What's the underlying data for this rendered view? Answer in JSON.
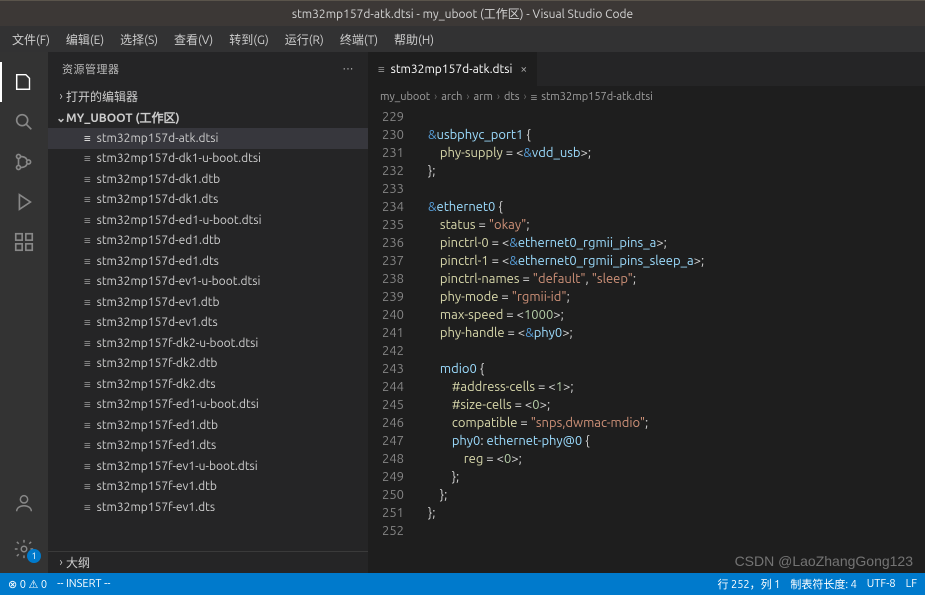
{
  "title": "stm32mp157d-atk.dtsi - my_uboot (工作区) - Visual Studio Code",
  "menu": [
    "文件(F)",
    "编辑(E)",
    "选择(S)",
    "查看(V)",
    "转到(G)",
    "运行(R)",
    "终端(T)",
    "帮助(H)"
  ],
  "activity_icons": [
    "files",
    "search",
    "scm",
    "debug",
    "extensions"
  ],
  "activity_bottom": [
    "account",
    "settings"
  ],
  "settings_badge": "1",
  "sidebar": {
    "title": "资源管理器",
    "ellipsis": "···",
    "open_editors": "打开的编辑器",
    "workspace": "MY_UBOOT (工作区)",
    "outline": "大纲",
    "files": [
      "stm32mp157d-atk.dtsi",
      "stm32mp157d-dk1-u-boot.dtsi",
      "stm32mp157d-dk1.dtb",
      "stm32mp157d-dk1.dts",
      "stm32mp157d-ed1-u-boot.dtsi",
      "stm32mp157d-ed1.dtb",
      "stm32mp157d-ed1.dts",
      "stm32mp157d-ev1-u-boot.dtsi",
      "stm32mp157d-ev1.dtb",
      "stm32mp157d-ev1.dts",
      "stm32mp157f-dk2-u-boot.dtsi",
      "stm32mp157f-dk2.dtb",
      "stm32mp157f-dk2.dts",
      "stm32mp157f-ed1-u-boot.dtsi",
      "stm32mp157f-ed1.dtb",
      "stm32mp157f-ed1.dts",
      "stm32mp157f-ev1-u-boot.dtsi",
      "stm32mp157f-ev1.dtb",
      "stm32mp157f-ev1.dts"
    ]
  },
  "tab": {
    "label": "stm32mp157d-atk.dtsi"
  },
  "breadcrumbs": [
    "my_uboot",
    "arch",
    "arm",
    "dts",
    "stm32mp157d-atk.dtsi"
  ],
  "code_start": 229,
  "code_tokens": [
    [],
    [
      [
        "amp",
        "&"
      ],
      [
        "var",
        "usbphyc_port1"
      ],
      [
        "punc",
        " {"
      ]
    ],
    [
      [
        "punc",
        "    "
      ],
      [
        "id",
        "phy-supply"
      ],
      [
        "punc",
        " = <"
      ],
      [
        "amp",
        "&"
      ],
      [
        "var",
        "vdd_usb"
      ],
      [
        "punc",
        ">;"
      ]
    ],
    [
      [
        "punc",
        "};"
      ]
    ],
    [],
    [
      [
        "amp",
        "&"
      ],
      [
        "var",
        "ethernet0"
      ],
      [
        "punc",
        " {"
      ]
    ],
    [
      [
        "punc",
        "    "
      ],
      [
        "id",
        "status"
      ],
      [
        "punc",
        " = "
      ],
      [
        "str",
        "\"okay\""
      ],
      [
        "punc",
        ";"
      ]
    ],
    [
      [
        "punc",
        "    "
      ],
      [
        "id",
        "pinctrl-0"
      ],
      [
        "punc",
        " = <"
      ],
      [
        "amp",
        "&"
      ],
      [
        "var",
        "ethernet0_rgmii_pins_a"
      ],
      [
        "punc",
        ">;"
      ]
    ],
    [
      [
        "punc",
        "    "
      ],
      [
        "id",
        "pinctrl-1"
      ],
      [
        "punc",
        " = <"
      ],
      [
        "amp",
        "&"
      ],
      [
        "var",
        "ethernet0_rgmii_pins_sleep_a"
      ],
      [
        "punc",
        ">;"
      ]
    ],
    [
      [
        "punc",
        "    "
      ],
      [
        "id",
        "pinctrl-names"
      ],
      [
        "punc",
        " = "
      ],
      [
        "str",
        "\"default\""
      ],
      [
        "punc",
        ", "
      ],
      [
        "str",
        "\"sleep\""
      ],
      [
        "punc",
        ";"
      ]
    ],
    [
      [
        "punc",
        "    "
      ],
      [
        "id",
        "phy-mode"
      ],
      [
        "punc",
        " = "
      ],
      [
        "str",
        "\"rgmii-id\""
      ],
      [
        "punc",
        ";"
      ]
    ],
    [
      [
        "punc",
        "    "
      ],
      [
        "id",
        "max-speed"
      ],
      [
        "punc",
        " = <"
      ],
      [
        "num",
        "1000"
      ],
      [
        "punc",
        ">;"
      ]
    ],
    [
      [
        "punc",
        "    "
      ],
      [
        "id",
        "phy-handle"
      ],
      [
        "punc",
        " = <"
      ],
      [
        "amp",
        "&"
      ],
      [
        "var",
        "phy0"
      ],
      [
        "punc",
        ">;"
      ]
    ],
    [],
    [
      [
        "punc",
        "    "
      ],
      [
        "var",
        "mdio0"
      ],
      [
        "punc",
        " {"
      ]
    ],
    [
      [
        "punc",
        "        "
      ],
      [
        "id",
        "#address-cells"
      ],
      [
        "punc",
        " = <"
      ],
      [
        "num",
        "1"
      ],
      [
        "punc",
        ">;"
      ]
    ],
    [
      [
        "punc",
        "        "
      ],
      [
        "id",
        "#size-cells"
      ],
      [
        "punc",
        " = <"
      ],
      [
        "num",
        "0"
      ],
      [
        "punc",
        ">;"
      ]
    ],
    [
      [
        "punc",
        "        "
      ],
      [
        "id",
        "compatible"
      ],
      [
        "punc",
        " = "
      ],
      [
        "str",
        "\"snps,dwmac-mdio\""
      ],
      [
        "punc",
        ";"
      ]
    ],
    [
      [
        "punc",
        "        "
      ],
      [
        "var",
        "phy0"
      ],
      [
        "punc",
        ": "
      ],
      [
        "var",
        "ethernet-phy@0"
      ],
      [
        "punc",
        " {"
      ]
    ],
    [
      [
        "punc",
        "            "
      ],
      [
        "id",
        "reg"
      ],
      [
        "punc",
        " = <"
      ],
      [
        "num",
        "0"
      ],
      [
        "punc",
        ">;"
      ]
    ],
    [
      [
        "punc",
        "        };"
      ]
    ],
    [
      [
        "punc",
        "    };"
      ]
    ],
    [
      [
        "punc",
        "};"
      ]
    ],
    []
  ],
  "status": {
    "errors": "0",
    "warnings": "0",
    "mode": "-- INSERT --",
    "line": "行 252，列 1",
    "tab": "制表符长度: 4",
    "enc": "UTF-8",
    "eol": "LF"
  },
  "watermark": "CSDN @LaoZhangGong123"
}
